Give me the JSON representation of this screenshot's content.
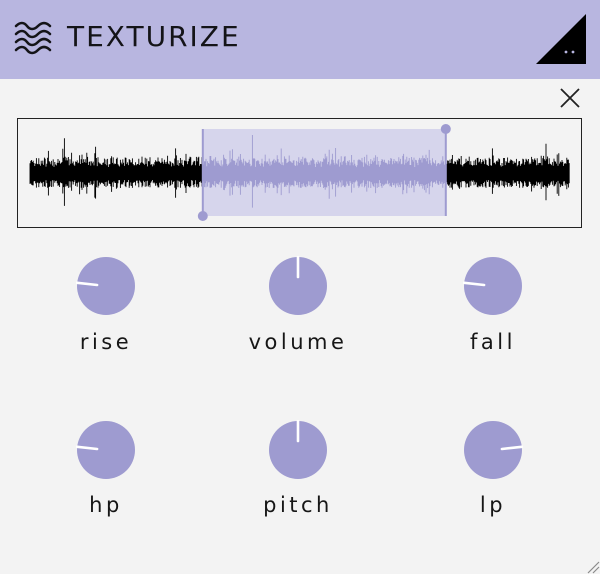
{
  "header": {
    "title": "TEXTURIZE",
    "background": "#b8b6e0",
    "logo_icon": "wave-lines-icon",
    "menu_icon": "corner-menu-icon"
  },
  "close_icon": "close-icon",
  "waveform": {
    "selection_start": 0.32,
    "selection_end": 0.77,
    "waveform_color": "#000000",
    "selection_color": "#9e9bd0",
    "selection_fill": "#d6d5ec"
  },
  "knobs": [
    {
      "id": "rise",
      "label": "rise",
      "value": 0.19
    },
    {
      "id": "volume",
      "label": "volume",
      "value": 0.5
    },
    {
      "id": "fall",
      "label": "fall",
      "value": 0.19
    },
    {
      "id": "hp",
      "label": "hp",
      "value": 0.19
    },
    {
      "id": "pitch",
      "label": "pitch",
      "value": 0.5
    },
    {
      "id": "lp",
      "label": "lp",
      "value": 0.81
    }
  ],
  "knob_color": "#9e9bd0",
  "accent": "#9e9bd0"
}
